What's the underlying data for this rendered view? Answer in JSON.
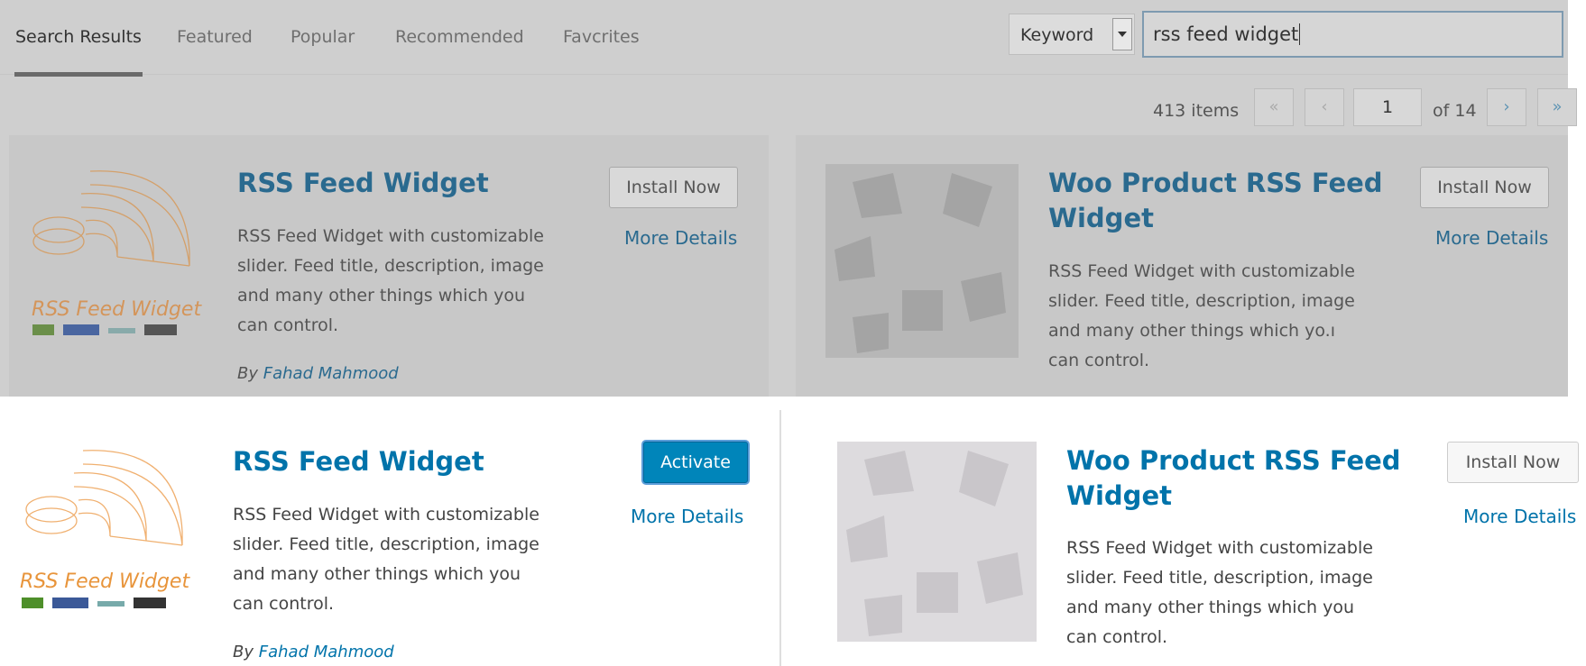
{
  "top": {
    "tabs": [
      "Search Results",
      "Featured",
      "Popular",
      "Recommended",
      "Favcrites"
    ],
    "search": {
      "type_label": "Keyword",
      "query": "rss feed widget"
    },
    "pagination": {
      "items": "413 items",
      "first": "«",
      "prev": "‹",
      "page": "1",
      "of": "of 14",
      "next": "›",
      "last": "»"
    },
    "cards": [
      {
        "title": "RSS Feed Widget",
        "desc": [
          "RSS Feed Widget with customizable",
          "slider. Feed title, description, image",
          "and many other things which you",
          "can control."
        ],
        "by": "By",
        "author": "Fahad Mahmood",
        "button": "Install Now",
        "more": "More Details",
        "logo_text": "RSS Feed Widget"
      },
      {
        "title_lines": [
          "Woo Product RSS Feed",
          "Widget"
        ],
        "desc": [
          "RSS Feed Widget with customizable",
          "slider. Feed title, description, image",
          "and many other things which yo.ı",
          "can control."
        ],
        "button": "Install Now",
        "more": "More Details"
      }
    ]
  },
  "bottom": {
    "cards": [
      {
        "title": "RSS Feed Widget",
        "desc": [
          "RSS Feed Widget with customizable",
          "slider. Feed title, description, image",
          "and many other things which you",
          "can control."
        ],
        "by": "By",
        "author": "Fahad Mahmood",
        "button": "Activate",
        "more": "More Details",
        "logo_text": "RSS Feed Widget"
      },
      {
        "title_lines": [
          "Woo Product RSS Feed",
          "Widget"
        ],
        "desc": [
          "RSS Feed Widget with customizable",
          "slider. Feed title, description, image",
          "and many other things which you",
          "can control."
        ],
        "button": "Install Now",
        "more": "More Details"
      }
    ]
  },
  "colors": {
    "accent": "#0073aa",
    "activate": "#0085ba",
    "logo_orange": "#e8a15a"
  }
}
